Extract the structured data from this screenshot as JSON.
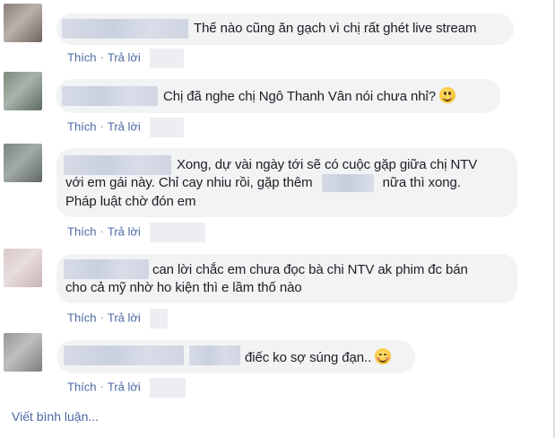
{
  "comments": [
    {
      "text": "Thế nào cũng ăn gạch vì chị rất ghét live stream",
      "actions": {
        "like": "Thích",
        "reply": "Trả lời"
      },
      "avatar_colors": [
        "#8a7f7b",
        "#b9b1ab",
        "#6f6560"
      ]
    },
    {
      "text": "Chị đã nghe chị Ngô Thanh Vân nói chưa nhỉ?",
      "emoji": "slightly-smiling-face-icon",
      "actions": {
        "like": "Thích",
        "reply": "Trả lời"
      },
      "avatar_colors": [
        "#7e8a80",
        "#a9b3aa",
        "#5d6a60"
      ]
    },
    {
      "lines": [
        "Xong, dự vài ngày tới sẽ có cuộc gặp giữa chị NTV",
        "với em gái này. Chỉ cay nhiu rồi, gặp thêm",
        "nữa thì xong.",
        "Pháp luật chờ đón em"
      ],
      "actions": {
        "like": "Thích",
        "reply": "Trả lời"
      },
      "avatar_colors": [
        "#7a8481",
        "#a3aba9",
        "#5e6866"
      ]
    },
    {
      "lines": [
        "can lời chắc em chưa đọc bà chi NTV ak phim đc bán",
        "cho cả mỹ nhờ ho kiện thì e lầm thố nào"
      ],
      "actions": {
        "like": "Thích",
        "reply": "Trả lời"
      },
      "avatar_colors": [
        "#d9c9c9",
        "#e8dcdc",
        "#c7b4b5"
      ]
    },
    {
      "text": "điếc ko sợ súng đạn..",
      "emoji": "blushing-smile-icon",
      "actions": {
        "like": "Thích",
        "reply": "Trả lời"
      },
      "avatar_colors": [
        "#9a9799",
        "#c1bec0",
        "#7f7c7e"
      ]
    }
  ],
  "write_comment": "Viết bình luận..."
}
